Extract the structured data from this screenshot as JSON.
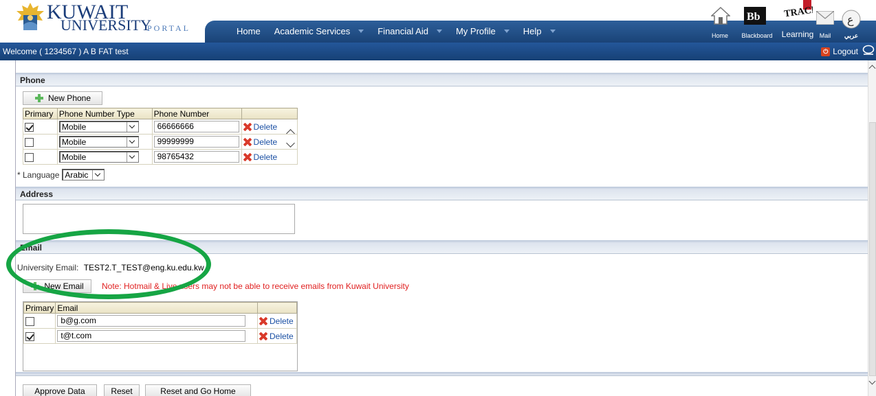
{
  "header": {
    "logo_line1": "KUWAIT",
    "logo_line2": "UNIVERSITY",
    "logo_portal": "PORTAL",
    "nav": [
      {
        "label": "Home",
        "has_dropdown": false
      },
      {
        "label": "Academic Services",
        "has_dropdown": true
      },
      {
        "label": "Financial Aid",
        "has_dropdown": true
      },
      {
        "label": "My Profile",
        "has_dropdown": true
      },
      {
        "label": "Help",
        "has_dropdown": true
      }
    ],
    "top_icons": [
      {
        "name": "home-icon",
        "label": "Home"
      },
      {
        "name": "blackboard-icon",
        "label": "Blackboard"
      },
      {
        "name": "learning-icon",
        "label": "Learning",
        "badge": "TRACK"
      },
      {
        "name": "mail-icon",
        "label": "Mail"
      },
      {
        "name": "arabic-icon",
        "label": "عربي",
        "glyph": "ع"
      }
    ]
  },
  "welcome": {
    "text": "Welcome ( 1234567 ) A B FAT test",
    "logout_label": "Logout"
  },
  "phone": {
    "section_title": "Phone",
    "new_button": "New Phone",
    "columns": [
      "Primary",
      "Phone Number Type",
      "Phone Number",
      ""
    ],
    "rows": [
      {
        "primary": true,
        "type": "Mobile",
        "number": "66666666",
        "delete_label": "Delete"
      },
      {
        "primary": false,
        "type": "Mobile",
        "number": "99999999",
        "delete_label": "Delete"
      },
      {
        "primary": false,
        "type": "Mobile",
        "number": "98765432",
        "delete_label": "Delete"
      }
    ],
    "language_label": "* Language",
    "language_value": "Arabic"
  },
  "address": {
    "section_title": "Address"
  },
  "email": {
    "section_title": "Email",
    "university_email_label": "University Email:",
    "university_email_value": "TEST2.T_TEST@eng.ku.edu.kw",
    "new_button": "New Email",
    "note": "Note: Hotmail & Live users may not be able to receive emails from Kuwait University",
    "columns": [
      "Primary",
      "Email",
      ""
    ],
    "rows": [
      {
        "primary": false,
        "email": "b@g.com",
        "delete_label": "Delete"
      },
      {
        "primary": true,
        "email": "t@t.com",
        "delete_label": "Delete"
      }
    ]
  },
  "actions": {
    "approve": "Approve Data",
    "reset": "Reset",
    "reset_home": "Reset and Go Home"
  },
  "colors": {
    "nav_blue": "#1a4377",
    "highlight_green": "#16a544",
    "note_red": "#e02020",
    "link_blue": "#1a4fa3"
  }
}
